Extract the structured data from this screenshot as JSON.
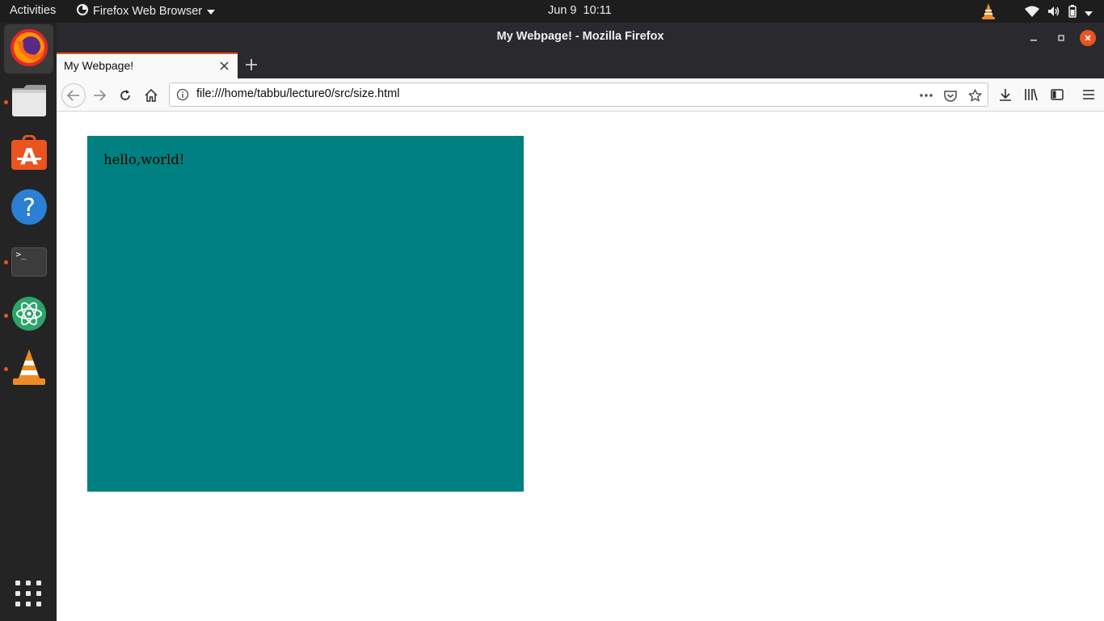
{
  "topbar": {
    "activities": "Activities",
    "app_name": "Firefox Web Browser",
    "clock": "Jun 9  10:11"
  },
  "dock": {
    "items": [
      {
        "name": "Firefox"
      },
      {
        "name": "Files"
      },
      {
        "name": "Ubuntu Software"
      },
      {
        "name": "Help"
      },
      {
        "name": "Terminal"
      },
      {
        "name": "Atom"
      },
      {
        "name": "VLC media player"
      }
    ],
    "terminal_prompt": ">_"
  },
  "window": {
    "title": "My Webpage! - Mozilla Firefox",
    "tab_title": "My Webpage!",
    "url": "file:///home/tabbu/lecture0/src/size.html"
  },
  "page": {
    "box_text": "hello,world!",
    "box_color": "#008080"
  },
  "colors": {
    "accent": "#e95420"
  }
}
